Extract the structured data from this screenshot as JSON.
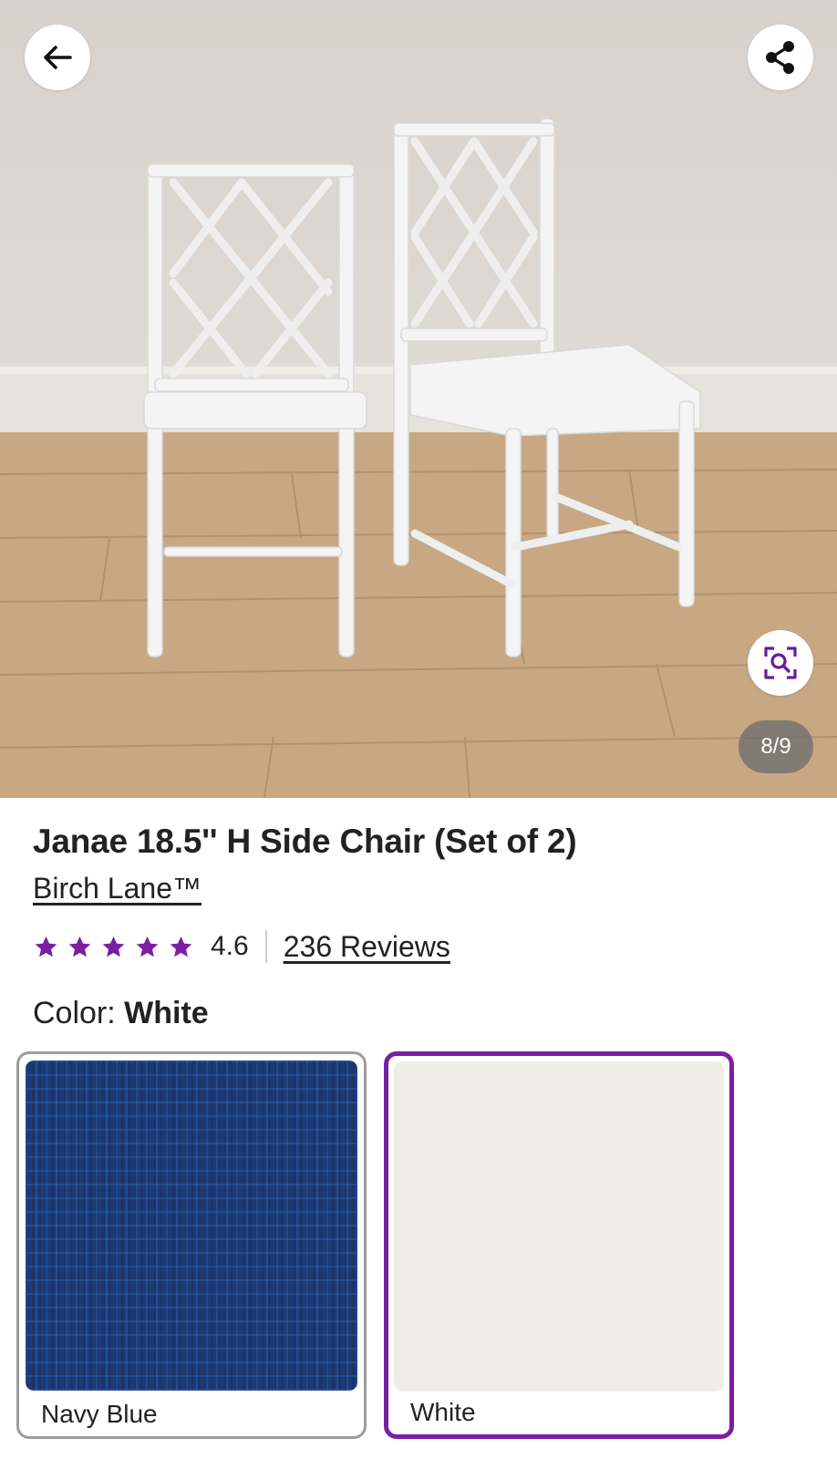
{
  "gallery": {
    "counter": "8/9",
    "back_icon": "arrow-left-icon",
    "share_icon": "share-icon",
    "zoom_icon": "zoom-search-icon"
  },
  "product": {
    "title": "Janae 18.5'' H Side Chair (Set of 2)",
    "brand": "Birch Lane™",
    "rating": {
      "stars": 5,
      "value": "4.6",
      "reviews_label": "236 Reviews"
    },
    "color": {
      "label": "Color:",
      "selected": "White"
    },
    "swatches": [
      {
        "label": "Navy Blue",
        "color": "#1d3a73",
        "selected": false
      },
      {
        "label": "White",
        "color": "#eeede6",
        "selected": true
      }
    ]
  },
  "colors": {
    "accent": "#7b1fa2",
    "star": "#7b1fa2"
  }
}
